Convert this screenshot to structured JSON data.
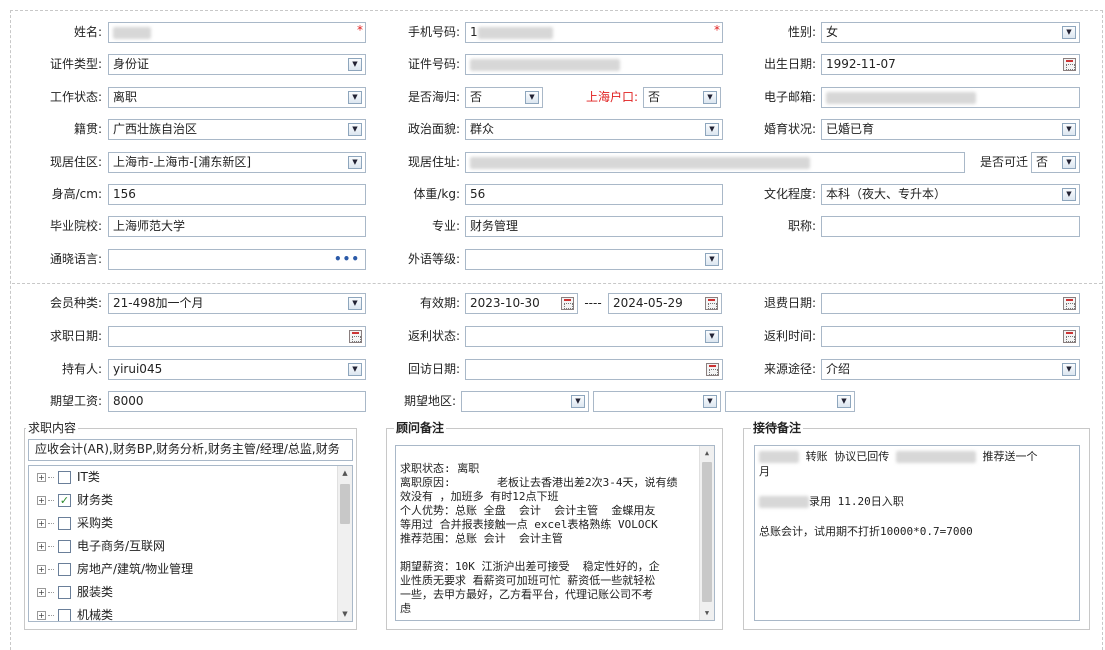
{
  "personal": {
    "name_label": "姓名:",
    "required_mark": "*",
    "phone_label": "手机号码:",
    "phone_value": "1",
    "gender_label": "性别:",
    "gender_value": "女",
    "idtype_label": "证件类型:",
    "idtype_value": "身份证",
    "idno_label": "证件号码:",
    "birth_label": "出生日期:",
    "birth_value": "1992-11-07",
    "workstatus_label": "工作状态:",
    "workstatus_value": "离职",
    "returnee_label": "是否海归:",
    "returnee_value": "否",
    "hukou_label": "上海户口:",
    "hukou_value": "否",
    "email_label": "电子邮箱:",
    "native_label": "籍贯:",
    "native_value": "广西壮族自治区",
    "political_label": "政治面貌:",
    "political_value": "群众",
    "marital_label": "婚育状况:",
    "marital_value": "已婚已育",
    "district_label": "现居住区:",
    "district_value": "上海市-上海市-[浦东新区]",
    "address_label": "现居住址:",
    "relocate_label": "是否可迁",
    "relocate_value": "否",
    "height_label": "身高/cm:",
    "height_value": "156",
    "weight_label": "体重/kg:",
    "weight_value": "56",
    "education_label": "文化程度:",
    "education_value": "本科（夜大、专升本）",
    "school_label": "毕业院校:",
    "school_value": "上海师范大学",
    "major_label": "专业:",
    "major_value": "财务管理",
    "title_label": "职称:",
    "language_label": "通晓语言:",
    "language_more": "•••",
    "foreign_label": "外语等级:"
  },
  "membership": {
    "type_label": "会员种类:",
    "type_value": "21-498加一个月",
    "valid_label": "有效期:",
    "valid_from": "2023-10-30",
    "valid_sep": "----",
    "valid_to": "2024-05-29",
    "refund_date_label": "退费日期:",
    "jobsearch_date_label": "求职日期:",
    "rebate_status_label": "返利状态:",
    "rebate_time_label": "返利时间:",
    "holder_label": "持有人:",
    "holder_value": "yirui045",
    "visit_date_label": "回访日期:",
    "source_label": "来源途径:",
    "source_value": "介绍",
    "salary_label": "期望工资:",
    "salary_value": "8000",
    "region_label": "期望地区:"
  },
  "job_content": {
    "title": "求职内容",
    "summary": "应收会计(AR),财务BP,财务分析,财务主管/经理/总监,财务",
    "tree": [
      {
        "label": "IT类",
        "checked": false
      },
      {
        "label": "财务类",
        "checked": true
      },
      {
        "label": "采购类",
        "checked": false
      },
      {
        "label": "电子商务/互联网",
        "checked": false
      },
      {
        "label": "房地产/建筑/物业管理",
        "checked": false
      },
      {
        "label": "服装类",
        "checked": false
      },
      {
        "label": "机械类",
        "checked": false
      }
    ]
  },
  "consultant": {
    "title": "顾问备注",
    "lines": [
      "求职状态: 离职",
      "离职原因:       老板让去香港出差2次3-4天，说有绩",
      "效没有 ，加班多 有时12点下班",
      "个人优势：总账 全盘  会计  会计主管  金蝶用友",
      "等用过 合并报表接触一点 excel表格熟练 VOLOCK",
      "推荐范围：总账 会计  会计主管",
      "",
      "期望薪资：10K 江浙沪出差可接受  稳定性好的，企",
      "业性质无要求 看薪资可加班可忙 薪资低一些就轻松",
      "一些，去甲方最好，乙方看平台，代理记账公司不考",
      "虑"
    ]
  },
  "reception": {
    "title": "接待备注",
    "line1a": "转账 协议已回传",
    "line1b": "推荐送一个",
    "line2": "月",
    "line3": "录用 11.20日入职",
    "line4": "总账会计，试用期不打折10000*0.7=7000"
  },
  "icons": {
    "dropdown": "dropdown-arrow-icon",
    "calendar": "calendar-icon",
    "expand": "tree-expand-icon",
    "checkbox": "checkbox-icon"
  },
  "colors": {
    "required": "#e02020",
    "border": "#a9b8c8",
    "checked": "#2a8a2a"
  }
}
